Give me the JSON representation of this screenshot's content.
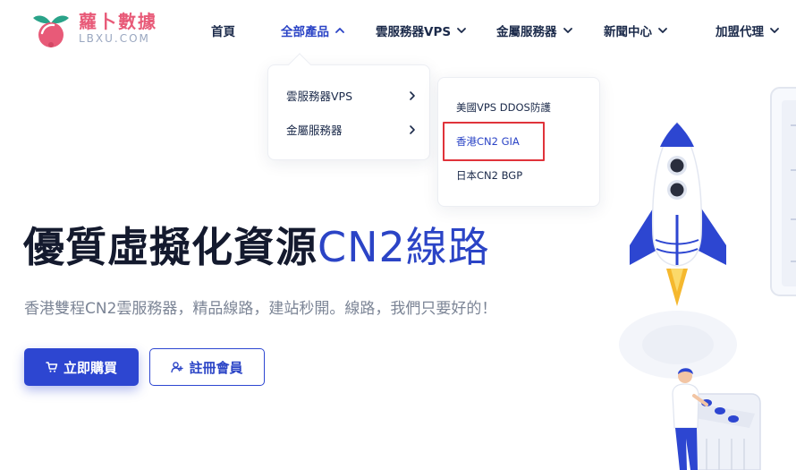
{
  "brand": {
    "name": "蘿卜數據",
    "domain": "LBXU.COM",
    "colors": {
      "logo_pink": "#e85a78",
      "logo_green": "#2aa389",
      "accent_blue": "#2b44c6",
      "highlight_red": "#e0333a"
    }
  },
  "nav": {
    "items": [
      {
        "label": "首頁",
        "has_chevron": false,
        "active": false
      },
      {
        "label": "全部產品",
        "has_chevron": true,
        "active": true,
        "expanded": true
      },
      {
        "label": "雲服務器VPS",
        "has_chevron": true,
        "active": false
      },
      {
        "label": "金屬服務器",
        "has_chevron": true,
        "active": false
      },
      {
        "label": "新聞中心",
        "has_chevron": true,
        "active": false
      },
      {
        "label": "加盟代理",
        "has_chevron": true,
        "active": false
      }
    ]
  },
  "products_menu": {
    "items": [
      {
        "label": "雲服務器VPS",
        "icon": "chevron-right-icon"
      },
      {
        "label": "金屬服務器",
        "icon": "chevron-right-icon"
      }
    ]
  },
  "submenu": {
    "items": [
      {
        "label": "美國VPS DDOS防護",
        "highlighted": false
      },
      {
        "label": "香港CN2 GIA",
        "highlighted": true
      },
      {
        "label": "日本CN2 BGP",
        "highlighted": false
      }
    ]
  },
  "hero": {
    "title_main": "優質虛擬化資源",
    "title_accent": "CN2線路",
    "subtitle": "香港雙程CN2雲服務器，精品線路，建站秒開。線路，我們只要好的！",
    "buy_button": {
      "label": "立即購買",
      "icon": "cart-icon"
    },
    "register_button": {
      "label": "註冊會員",
      "icon": "user-plus-icon"
    }
  }
}
